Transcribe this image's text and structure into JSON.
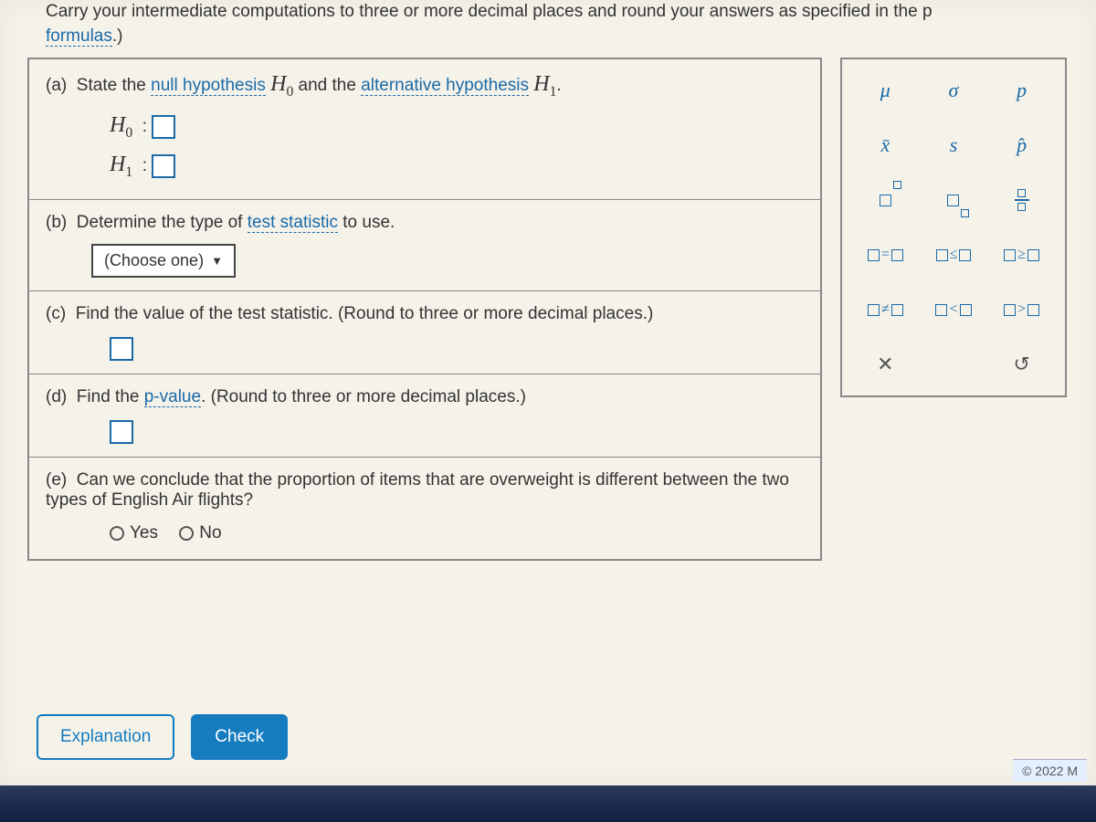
{
  "intro": {
    "pre": "Carry your intermediate computations to three or more decimal places and round your answers as specified in the p",
    "link": "formulas",
    "post": ".)"
  },
  "parts": {
    "a": {
      "label": "(a)",
      "text_pre": "State the ",
      "link1": "null hypothesis",
      "mid": " and the ",
      "link2": "alternative hypothesis",
      "end": ".",
      "h0": "H",
      "h0sub": "0",
      "h1": "H",
      "h1sub": "1",
      "colon": ":"
    },
    "b": {
      "label": "(b)",
      "text_pre": "Determine the type of ",
      "link": "test statistic",
      "text_post": " to use.",
      "dropdown": "(Choose one)"
    },
    "c": {
      "label": "(c)",
      "text": "Find the value of the test statistic. (Round to three or more decimal places.)"
    },
    "d": {
      "label": "(d)",
      "text_pre": "Find the ",
      "link": "p-value",
      "text_post": ". (Round to three or more decimal places.)"
    },
    "e": {
      "label": "(e)",
      "text": "Can we conclude that the proportion of items that are overweight is different between the two types of English Air flights?",
      "yes": "Yes",
      "no": "No"
    }
  },
  "palette": {
    "r1": {
      "a": "μ",
      "b": "σ",
      "c": "p"
    },
    "r2": {
      "a": "x̄",
      "b": "s",
      "c": "p̂"
    },
    "r4": {
      "a_op": "=",
      "b_op": "≤",
      "c_op": "≥"
    },
    "r5": {
      "a_op": "≠",
      "b_op": "<",
      "c_op": ">"
    }
  },
  "buttons": {
    "explanation": "Explanation",
    "check": "Check"
  },
  "copyright": "© 2022 M"
}
